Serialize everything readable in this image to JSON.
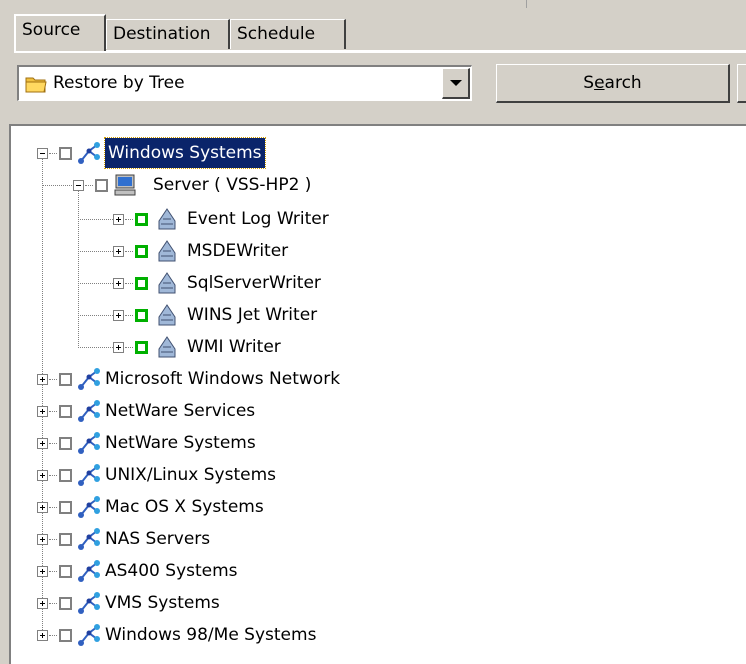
{
  "tabs": [
    {
      "label": "Source",
      "active": true
    },
    {
      "label": "Destination",
      "active": false
    },
    {
      "label": "Schedule",
      "active": false
    }
  ],
  "restore_combo": {
    "value": "Restore by Tree",
    "icon": "folder-icon"
  },
  "buttons": {
    "search_label": "Search",
    "search_accesskey": "e"
  },
  "tree": {
    "root": {
      "label": "Windows Systems",
      "selected": true,
      "icon": "network-icon"
    },
    "server": {
      "label": "Server ( VSS-HP2 )",
      "icon": "computer-icon"
    },
    "writers": [
      {
        "label": "Event Log Writer"
      },
      {
        "label": "MSDEWriter"
      },
      {
        "label": "SqlServerWriter"
      },
      {
        "label": "WINS Jet Writer"
      },
      {
        "label": "WMI Writer"
      }
    ],
    "other_roots": [
      {
        "label": "Microsoft Windows Network"
      },
      {
        "label": "NetWare Services"
      },
      {
        "label": "NetWare Systems"
      },
      {
        "label": "UNIX/Linux Systems"
      },
      {
        "label": "Mac OS X Systems"
      },
      {
        "label": "NAS Servers"
      },
      {
        "label": "AS400 Systems"
      },
      {
        "label": "VMS Systems"
      },
      {
        "label": "Windows 98/Me Systems"
      }
    ]
  },
  "colors": {
    "selection": "#0a246a",
    "check_green": "#00b000",
    "window_bg": "#d4d0c8"
  }
}
